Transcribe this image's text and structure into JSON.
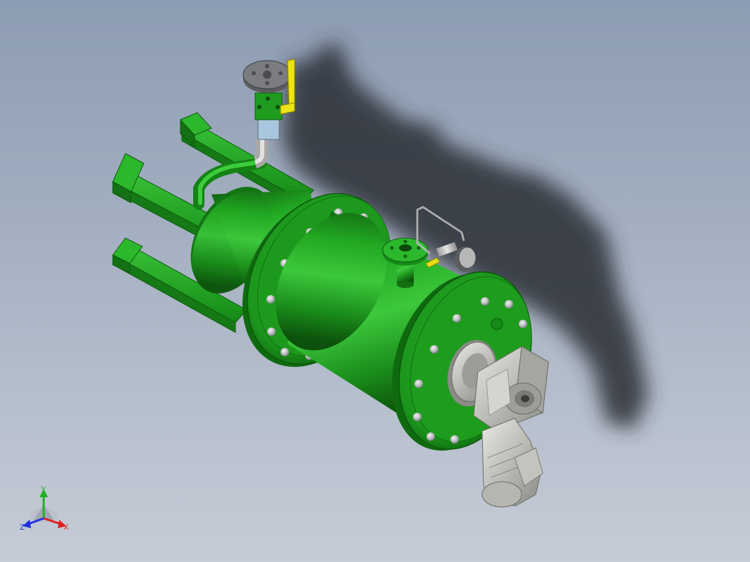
{
  "viewport": {
    "background_top": "#8c9cb2",
    "background_bottom": "#c4cad6",
    "model_color": "#1e9c1e",
    "model_dark": "#126612",
    "model_light": "#4cd64c",
    "bolt_color": "#b9bcc0",
    "motor_color": "#c8c8c4",
    "handle_color": "#e8e010",
    "shadow_color": "#2a2d33"
  },
  "triad": {
    "x_label": "X",
    "y_label": "Y",
    "z_label": "Z",
    "x_color": "#e02020",
    "y_color": "#20b020",
    "z_color": "#2030e0"
  }
}
